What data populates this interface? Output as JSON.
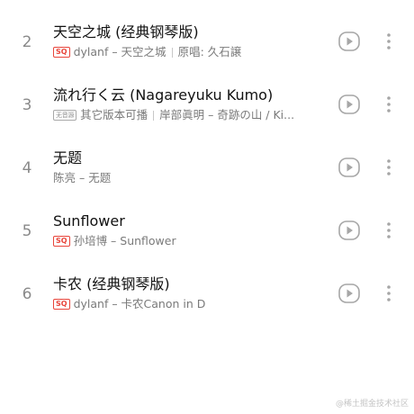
{
  "songs": [
    {
      "index": "2",
      "title": "天空之城 (经典钢琴版)",
      "badge": "SQ",
      "badge_style": "sq",
      "artist_album": "dylanf – 天空之城",
      "extra": "原唱: 久石譲"
    },
    {
      "index": "3",
      "title": "流れ行く云 (Nagareyuku Kumo)",
      "badge": "无音源",
      "badge_style": "gray",
      "artist_album": "其它版本可播",
      "extra": "岸部眞明 – 奇跡の山 / Ki..."
    },
    {
      "index": "4",
      "title": "无题",
      "badge": "",
      "artist_album": "陈亮 – 无题",
      "extra": ""
    },
    {
      "index": "5",
      "title": "Sunflower",
      "badge": "SQ",
      "badge_style": "sq",
      "artist_album": "孙培博 – Sunflower",
      "extra": ""
    },
    {
      "index": "6",
      "title": "卡农 (经典钢琴版)",
      "badge": "SQ",
      "badge_style": "sq",
      "artist_album": "dylanf – 卡农Canon in D",
      "extra": ""
    }
  ],
  "icons": {
    "play": "play-circle-icon",
    "more": "more-vertical-icon"
  },
  "colors": {
    "title": "#111111",
    "meta": "#7a7a7a",
    "badge_sq": "#e8443a",
    "icon": "#a6a6a6"
  },
  "watermark": "@稀土掘金技术社区"
}
